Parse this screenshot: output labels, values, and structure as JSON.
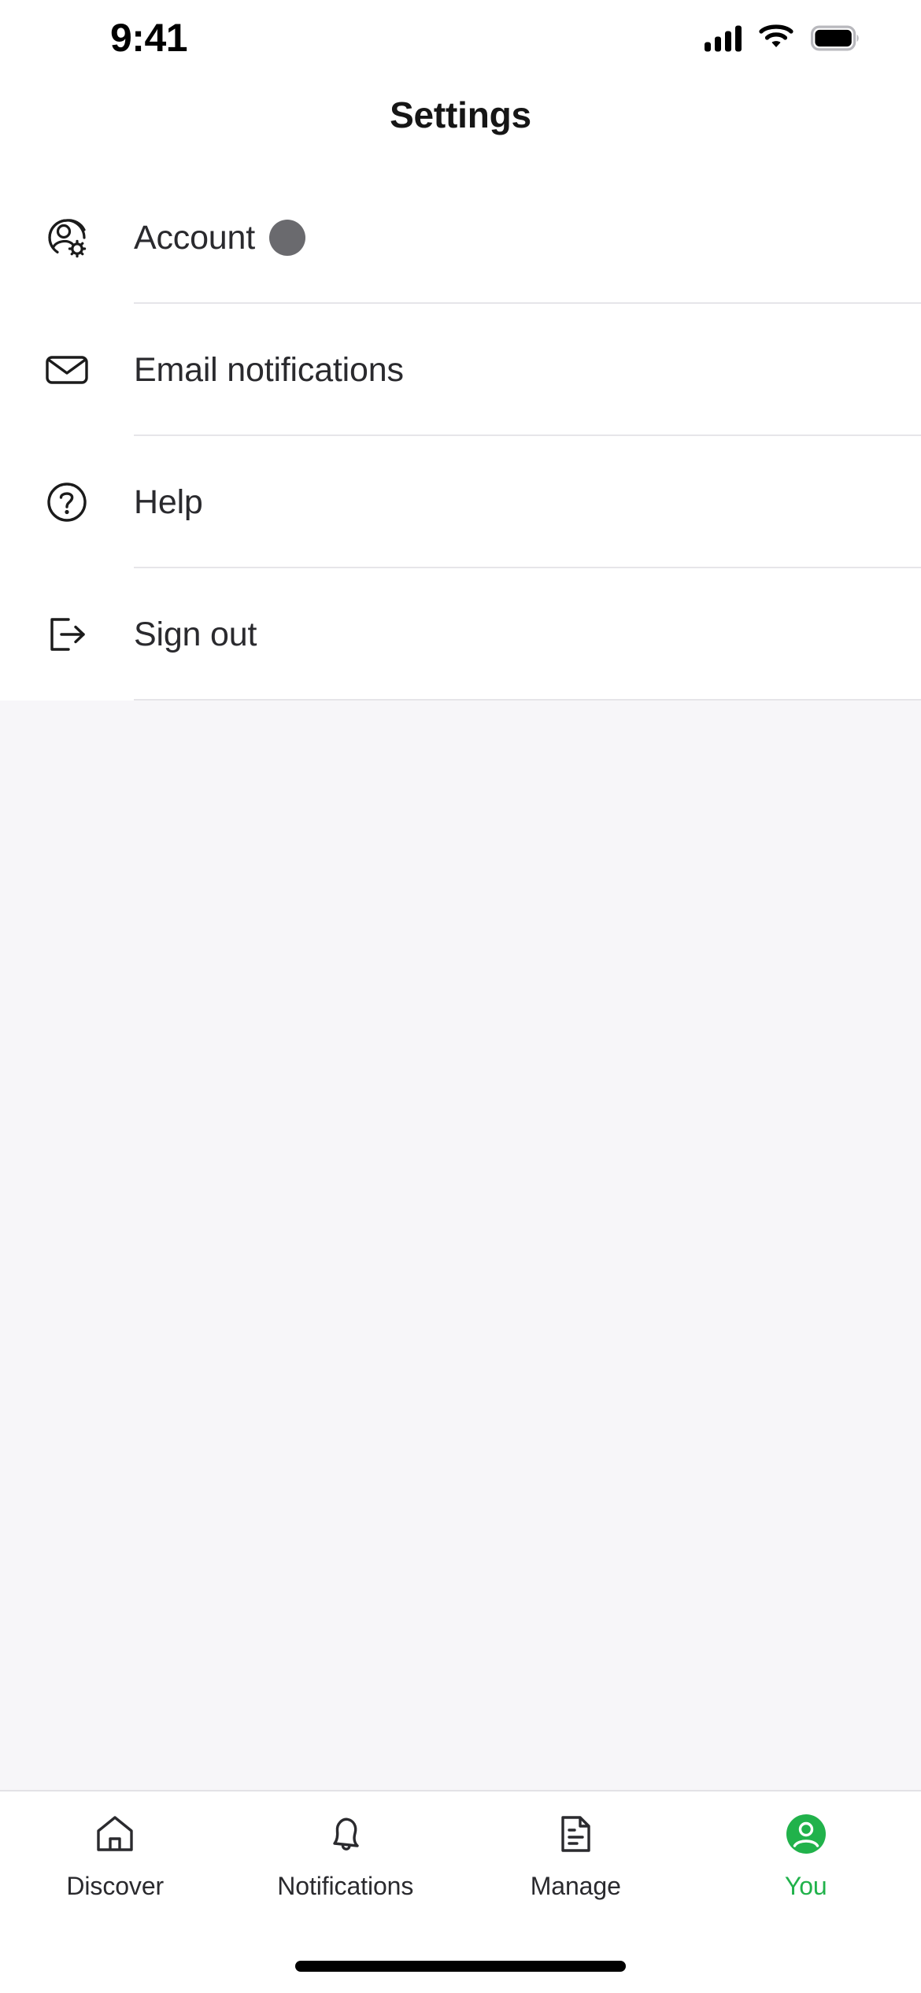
{
  "status_bar": {
    "time": "9:41",
    "cellular_icon": "cellular-signal-icon",
    "cellular_bars": 4,
    "wifi_icon": "wifi-icon",
    "battery_icon": "battery-full-icon",
    "battery_level": "100"
  },
  "header": {
    "title": "Settings"
  },
  "settings": {
    "rows": [
      {
        "label": "Account",
        "icon": "account-gear-icon",
        "has_avatar": true,
        "avatar_color": "#6a6a6e"
      },
      {
        "label": "Email notifications",
        "icon": "envelope-icon",
        "has_avatar": false
      },
      {
        "label": "Help",
        "icon": "question-circle-icon",
        "has_avatar": false
      },
      {
        "label": "Sign out",
        "icon": "sign-out-icon",
        "has_avatar": false
      }
    ]
  },
  "tab_bar": {
    "active_index": 3,
    "active_color": "#21b24b",
    "inactive_color": "#2a2a2e",
    "tabs": [
      {
        "label": "Discover",
        "icon": "home-icon"
      },
      {
        "label": "Notifications",
        "icon": "bell-icon"
      },
      {
        "label": "Manage",
        "icon": "document-icon"
      },
      {
        "label": "You",
        "icon": "person-avatar-icon"
      }
    ]
  },
  "home_indicator": {
    "name": "home-indicator"
  }
}
